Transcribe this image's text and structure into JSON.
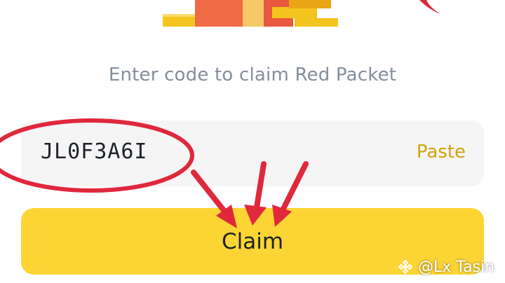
{
  "redpacket": {
    "title": "Enter code to claim Red Packet",
    "code_value": "JL0F3A6I",
    "paste_label": "Paste",
    "claim_label": "Claim"
  },
  "watermark": {
    "text": "@Lx Tasin",
    "icon": "binance-logo-icon"
  },
  "colors": {
    "background": "#ffffff",
    "title_text": "#848e9c",
    "input_background": "#f5f5f5",
    "code_text": "#1e2329",
    "paste_text": "#d0a20e",
    "claim_background": "#fcd535",
    "claim_text": "#1e2329",
    "annotation_red": "#e0283c"
  },
  "icons": [
    "red-packet-illustration",
    "binance-logo-icon"
  ]
}
